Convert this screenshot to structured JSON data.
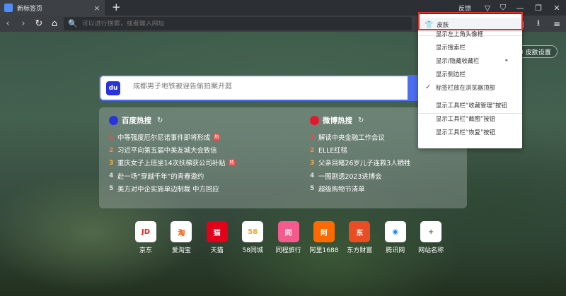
{
  "tab": {
    "title": "新标签页",
    "close": "×"
  },
  "tabbar": {
    "new_tab": "+",
    "feedback": "反馈",
    "chevron": "▽",
    "skin_icon": "⛉",
    "minimize": "—",
    "maximize": "❐",
    "close": "✕"
  },
  "toolbar": {
    "back": "‹",
    "forward": "›",
    "reload": "↻",
    "home": "⌂",
    "search_icon": "🔍",
    "placeholder": "可以进行搜索，或者输入网址",
    "grid": "▦",
    "download": "⭳",
    "menu": "≡"
  },
  "skin_settings": {
    "label": "皮肤设置",
    "icon": "◎"
  },
  "search": {
    "logo": "du",
    "placeholder": "成都男子地铁被诬告偷拍案开庭"
  },
  "baidu_hot": {
    "title": "百度热搜",
    "refresh": "↻",
    "items": [
      {
        "rank": "1",
        "text": "中等强度厄尔尼诺事件即将形成",
        "badge": "热"
      },
      {
        "rank": "2",
        "text": "习近平向第五届中美友城大会致信",
        "badge": ""
      },
      {
        "rank": "3",
        "text": "重庆女子上班坐14次扶梯获公司补贴",
        "badge": "热"
      },
      {
        "rank": "4",
        "text": "赴一场“穿越千年”的青春邀约",
        "badge": ""
      },
      {
        "rank": "5",
        "text": "美方对中企实施单边制裁 中方回应",
        "badge": ""
      }
    ]
  },
  "weibo_hot": {
    "title": "微博热搜",
    "refresh": "↻",
    "items": [
      {
        "rank": "1",
        "text": "解读中央金融工作会议"
      },
      {
        "rank": "2",
        "text": "ELLE红毯"
      },
      {
        "rank": "3",
        "text": "父亲目睹26岁儿子连救3人牺牲"
      },
      {
        "rank": "4",
        "text": "一图剧透2023进博会"
      },
      {
        "rank": "5",
        "text": "超级购物节清单"
      }
    ]
  },
  "shortcuts": [
    {
      "label": "京东",
      "glyph": "JD",
      "color": "#e1251b"
    },
    {
      "label": "爱淘宝",
      "glyph": "淘",
      "color": "#ff5000"
    },
    {
      "label": "天猫",
      "glyph": "猫",
      "color": "#ffffff",
      "bg": "#e4001b"
    },
    {
      "label": "58同城",
      "glyph": "58",
      "color": "#f5a623"
    },
    {
      "label": "同程旅行",
      "glyph": "同",
      "color": "#ffffff",
      "bg": "#f45b8c"
    },
    {
      "label": "阿里1688",
      "glyph": "阿",
      "color": "#ffffff",
      "bg": "#ff6a00"
    },
    {
      "label": "东方财富",
      "glyph": "东",
      "color": "#ffffff",
      "bg": "#ea4c24"
    },
    {
      "label": "腾讯网",
      "glyph": "◉",
      "color": "#1a8ae5"
    },
    {
      "label": "网站名称",
      "glyph": "+",
      "color": "#666666"
    }
  ],
  "menu": {
    "skin": "皮肤",
    "shirt_icon": "👕",
    "items": [
      {
        "label": "显示左上角头像框"
      },
      {
        "label": "显示搜索栏"
      },
      {
        "label": "显示/隐藏收藏栏"
      },
      {
        "label": "显示侧边栏"
      },
      {
        "label": "标签栏放在浏览器顶部",
        "checked": true
      },
      {
        "label": "显示工具栏“收藏管理”按钮"
      },
      {
        "label": "显示工具栏“截图”按钮"
      },
      {
        "label": "显示工具栏“恢复”按钮"
      }
    ],
    "submenu_arrow": "▸",
    "check": "✓"
  }
}
